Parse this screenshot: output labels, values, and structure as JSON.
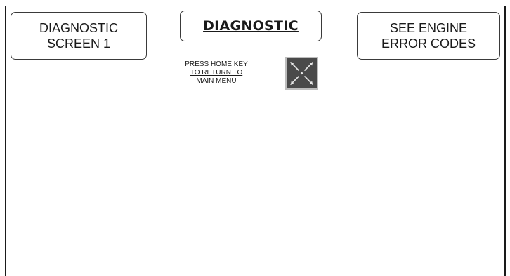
{
  "buttons": {
    "diagnostic_screen_1": "DIAGNOSTIC\nSCREEN 1",
    "title": "DIAGNOSTIC",
    "engine_error_codes": "SEE ENGINE\nERROR CODES"
  },
  "home_note": {
    "lines": [
      "PRESS HOME KEY",
      "TO RETURN TO",
      "MAIN MENU"
    ]
  },
  "home_key": {
    "icon": "home-key-icon"
  },
  "colors": {
    "background": "#ffffff",
    "text": "#1a1a1a",
    "border": "#3a3a3a",
    "key_fill": "#4a4a4a"
  }
}
